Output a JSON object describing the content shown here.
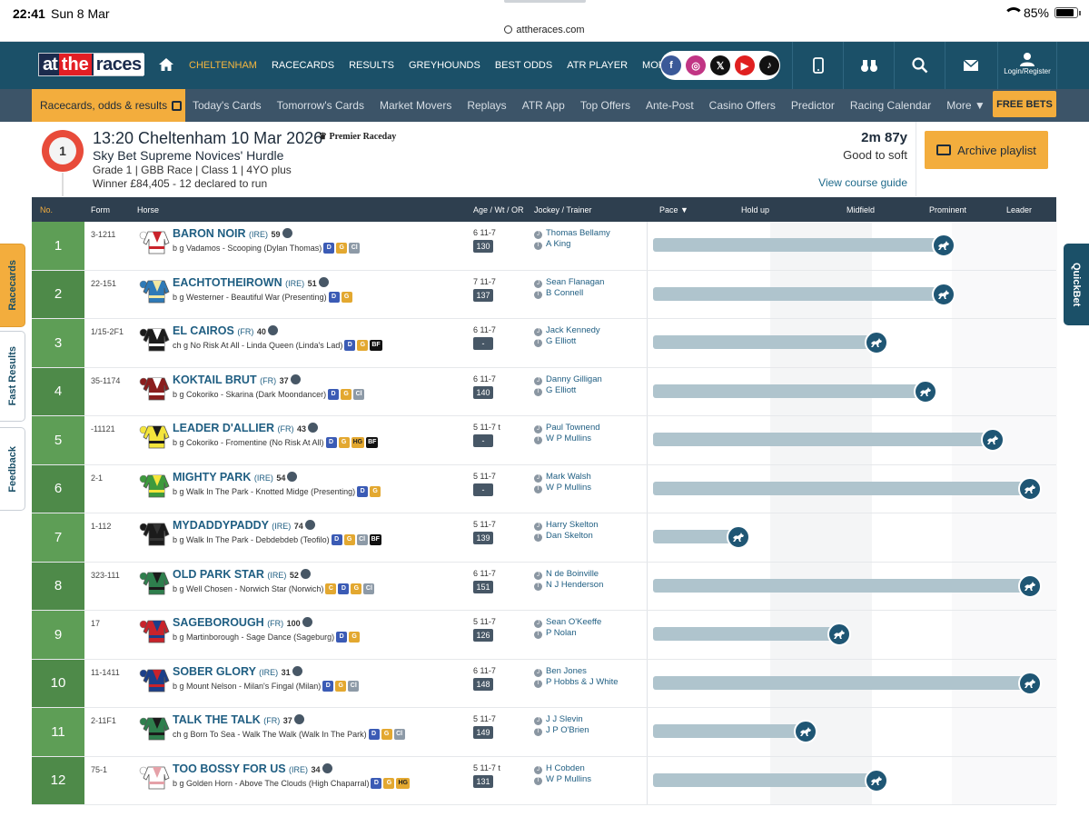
{
  "status": {
    "time": "22:41",
    "date": "Sun 8 Mar",
    "url": "attheraces.com",
    "battery": "85%",
    "battery_level": 0.85
  },
  "nav": {
    "logo": {
      "at": "at",
      "the": "the",
      "races": "races"
    },
    "links": [
      "CHELTENHAM",
      "RACECARDS",
      "RESULTS",
      "GREYHOUNDS",
      "BEST ODDS",
      "ATR PLAYER",
      "MORE ▼"
    ],
    "active": "CHELTENHAM",
    "login": "Login/Register",
    "social": [
      "facebook-icon",
      "instagram-icon",
      "x-icon",
      "youtube-icon",
      "tiktok-icon"
    ]
  },
  "subnav": {
    "active": "Racecards, odds & results",
    "links": [
      "Today's Cards",
      "Tomorrow's Cards",
      "Market Movers",
      "Replays",
      "ATR App",
      "Top Offers",
      "Ante-Post",
      "Casino Offers",
      "Predictor",
      "Racing Calendar",
      "More ▼"
    ],
    "free_bets": "FREE BETS"
  },
  "race": {
    "number": "1",
    "title": "13:20 Cheltenham 10 Mar 2026",
    "sponsor": "Premier Raceday",
    "name": "Sky Bet Supreme Novices' Hurdle",
    "meta1": "Grade 1 | GBB Race | Class 1 | 4YO plus",
    "meta2": "Winner £84,405 - 12 declared to run",
    "distance": "2m 87y",
    "going": "Good to soft",
    "course_guide": "View course guide",
    "archive": "Archive playlist"
  },
  "table": {
    "headers": {
      "no": "No.",
      "form": "Form",
      "horse": "Horse",
      "awo": "Age / Wt / OR",
      "jt": "Jockey / Trainer",
      "pace": "Pace ▼",
      "hold": "Hold up",
      "mid": "Midfield",
      "prom": "Prominent",
      "lead": "Leader"
    },
    "runners": [
      {
        "no": "1",
        "form": "3-1211",
        "name": "BARON NOIR",
        "cty": "(IRE)",
        "rating": "59",
        "breed": "b g Vadamos - Scooping (Dylan Thomas)",
        "badges": [
          "D",
          "G",
          "Cl"
        ],
        "awo": "6 11-7",
        "or": "130",
        "jockey": "Thomas Bellamy",
        "trainer": "A King",
        "pace": 0.75
      },
      {
        "no": "2",
        "form": "22-151",
        "name": "EACHTOTHEIROWN",
        "cty": "(IRE)",
        "rating": "51",
        "breed": "b g Westerner - Beautiful War (Presenting)",
        "badges": [
          "D",
          "G"
        ],
        "awo": "7 11-7",
        "or": "137",
        "jockey": "Sean Flanagan",
        "trainer": "B Connell",
        "pace": 0.75
      },
      {
        "no": "3",
        "form": "1/15-2F1",
        "name": "EL CAIROS",
        "cty": "(FR)",
        "rating": "40",
        "breed": "ch g No Risk At All - Linda Queen (Linda's Lad)",
        "badges": [
          "D",
          "G",
          "BF"
        ],
        "awo": "6 11-7",
        "or": "-",
        "jockey": "Jack Kennedy",
        "trainer": "G Elliott",
        "pace": 0.57
      },
      {
        "no": "4",
        "form": "35-1174",
        "name": "KOKTAIL BRUT",
        "cty": "(FR)",
        "rating": "37",
        "breed": "b g Cokoriko - Skarina (Dark Moondancer)",
        "badges": [
          "D",
          "G",
          "Cl"
        ],
        "awo": "6 11-7",
        "or": "140",
        "jockey": "Danny Gilligan",
        "trainer": "G Elliott",
        "pace": 0.7
      },
      {
        "no": "5",
        "form": "-11121",
        "name": "LEADER D'ALLIER",
        "cty": "(FR)",
        "rating": "43",
        "breed": "b g Cokoriko - Fromentine (No Risk At All)",
        "badges": [
          "D",
          "G",
          "HG",
          "BF"
        ],
        "awo": "5 11-7 t",
        "or": "-",
        "jockey": "Paul Townend",
        "trainer": "W P Mullins",
        "pace": 0.88
      },
      {
        "no": "6",
        "form": "2-1",
        "name": "MIGHTY PARK",
        "cty": "(IRE)",
        "rating": "54",
        "breed": "b g Walk In The Park - Knotted Midge (Presenting)",
        "badges": [
          "D",
          "G"
        ],
        "awo": "5 11-7",
        "or": "-",
        "jockey": "Mark Walsh",
        "trainer": "W P Mullins",
        "pace": 0.98
      },
      {
        "no": "7",
        "form": "1-112",
        "name": "MYDADDYPADDY",
        "cty": "(IRE)",
        "rating": "74",
        "breed": "b g Walk In The Park - Debdebdeb (Teofilo)",
        "badges": [
          "D",
          "G",
          "Cl",
          "BF"
        ],
        "awo": "5 11-7",
        "or": "139",
        "jockey": "Harry Skelton",
        "trainer": "Dan Skelton",
        "pace": 0.2
      },
      {
        "no": "8",
        "form": "323-111",
        "name": "OLD PARK STAR",
        "cty": "(IRE)",
        "rating": "52",
        "breed": "b g Well Chosen - Norwich Star (Norwich)",
        "badges": [
          "C",
          "D",
          "G",
          "Cl"
        ],
        "awo": "6 11-7",
        "or": "151",
        "jockey": "N de Boinville",
        "trainer": "N J Henderson",
        "pace": 0.98
      },
      {
        "no": "9",
        "form": "17",
        "name": "SAGEBOROUGH",
        "cty": "(FR)",
        "rating": "100",
        "breed": "b g Martinborough - Sage Dance (Sageburg)",
        "badges": [
          "D",
          "G"
        ],
        "awo": "5 11-7",
        "or": "126",
        "jockey": "Sean O'Keeffe",
        "trainer": "P Nolan",
        "pace": 0.47
      },
      {
        "no": "10",
        "form": "11-1411",
        "name": "SOBER GLORY",
        "cty": "(IRE)",
        "rating": "31",
        "breed": "b g Mount Nelson - Milan's Fingal (Milan)",
        "badges": [
          "D",
          "G",
          "Cl"
        ],
        "awo": "6 11-7",
        "or": "148",
        "jockey": "Ben Jones",
        "trainer": "P Hobbs & J White",
        "pace": 0.98
      },
      {
        "no": "11",
        "form": "2-11F1",
        "name": "TALK THE TALK",
        "cty": "(FR)",
        "rating": "37",
        "breed": "ch g Born To Sea - Walk The Walk (Walk In The Park)",
        "badges": [
          "D",
          "G",
          "Cl"
        ],
        "awo": "5 11-7",
        "or": "149",
        "jockey": "J J Slevin",
        "trainer": "J P O'Brien",
        "pace": 0.38
      },
      {
        "no": "12",
        "form": "75-1",
        "name": "TOO BOSSY FOR US",
        "cty": "(IRE)",
        "rating": "34",
        "breed": "b g Golden Horn - Above The Clouds (High Chaparral)",
        "badges": [
          "D",
          "G",
          "HG"
        ],
        "awo": "5 11-7 t",
        "or": "131",
        "jockey": "H Cobden",
        "trainer": "W P Mullins",
        "pace": 0.57
      }
    ]
  },
  "side_tabs": {
    "racecards": "Racecards",
    "fast_results": "Fast Results",
    "feedback": "Feedback",
    "quickbet": "QuickBet"
  },
  "colors": {
    "nav": "#1b5068",
    "accent": "#f3ad3d",
    "row_green": "#5e9e56",
    "pace_bar": "#afc4cd",
    "marker": "#1f5674"
  }
}
